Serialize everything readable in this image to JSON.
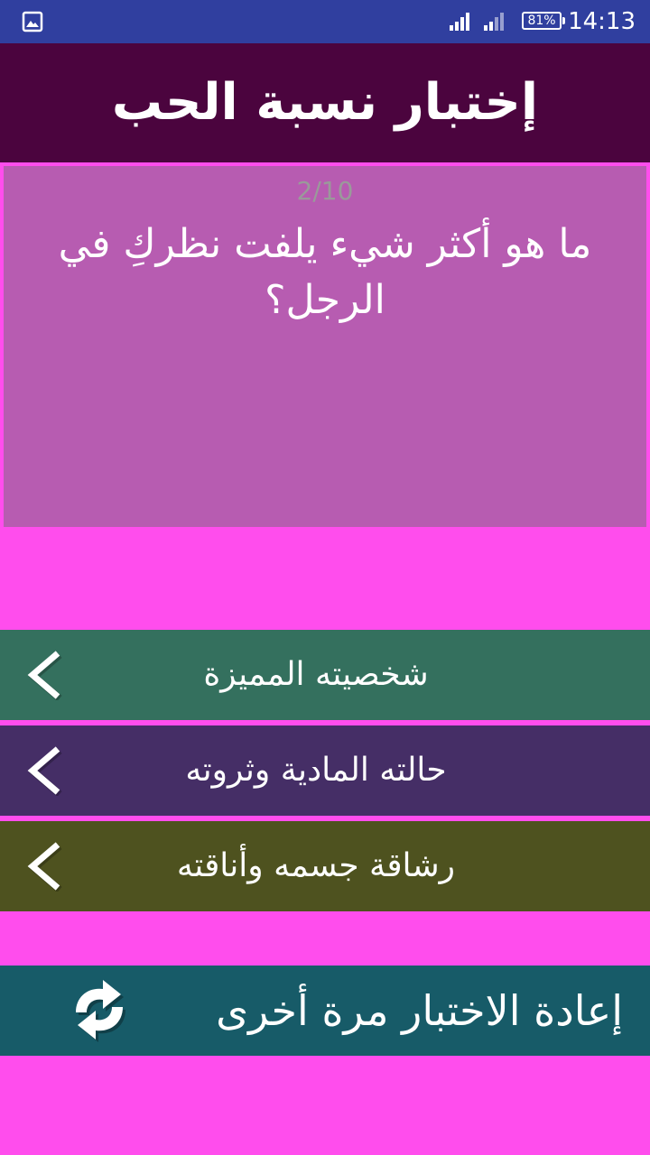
{
  "status_bar": {
    "battery": "81%",
    "time": "14:13",
    "icons": [
      "gallery-icon",
      "signal-icon",
      "signal-icon",
      "battery-icon"
    ]
  },
  "app_bar": {
    "title": "إختبار نسبة الحب"
  },
  "question": {
    "counter": "2/10",
    "text": "ما هو أكثر شيء يلفت نظركِ في الرجل؟"
  },
  "answers": [
    {
      "label": "شخصيته المميزة",
      "color": "#34705e"
    },
    {
      "label": "حالته المادية وثروته",
      "color": "#452e66"
    },
    {
      "label": "رشاقة جسمه وأناقته",
      "color": "#4e521f"
    }
  ],
  "retry": {
    "label": "إعادة الاختبار مرة أخرى",
    "icon": "refresh-icon"
  },
  "colors": {
    "background": "#ff4ded",
    "app_bar": "#4b043e",
    "status_bar": "#303f9f",
    "question_card": "#b75cb1",
    "retry": "#175b68"
  }
}
